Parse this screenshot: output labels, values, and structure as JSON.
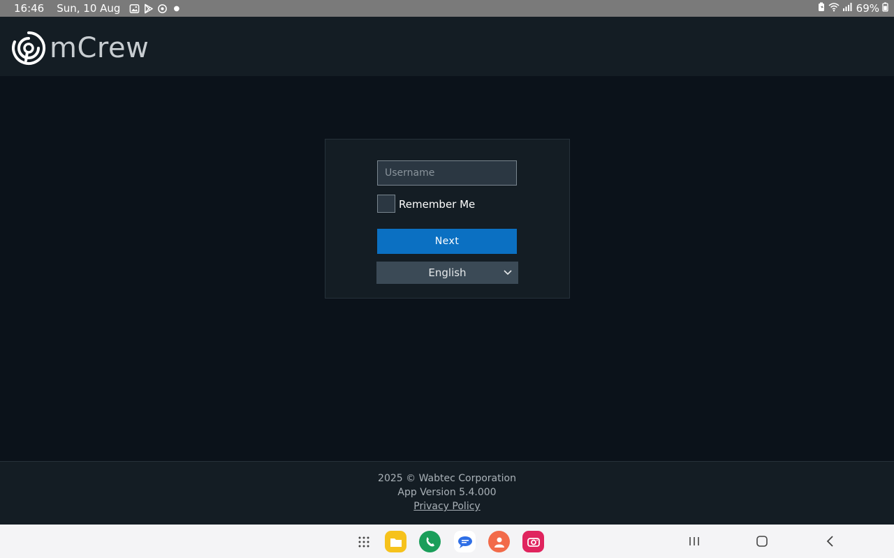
{
  "status_bar": {
    "time": "16:46",
    "date": "Sun, 10 Aug",
    "battery": "69%"
  },
  "header": {
    "app_name": "mCrew"
  },
  "login": {
    "username_placeholder": "Username",
    "username_value": "",
    "remember_me_label": "Remember Me",
    "remember_me_checked": false,
    "next_label": "Next",
    "language_selected": "English"
  },
  "footer": {
    "copyright": "2025 © Wabtec Corporation",
    "version": "App Version 5.4.000",
    "privacy_link": "Privacy Policy"
  },
  "dock": {
    "apps": [
      {
        "icon": "app-drawer-icon"
      },
      {
        "icon": "files-icon",
        "color": "#f6c21c"
      },
      {
        "icon": "phone-icon",
        "color": "#1a9e5a"
      },
      {
        "icon": "messages-icon",
        "color": "#2f6fe6"
      },
      {
        "icon": "contacts-icon",
        "color": "#f26b4a"
      },
      {
        "icon": "camera-icon",
        "color": "#e0245e"
      }
    ]
  },
  "colors": {
    "accent": "#0b70c2",
    "header_bg": "#141d24",
    "page_bg": "#0b121a"
  }
}
